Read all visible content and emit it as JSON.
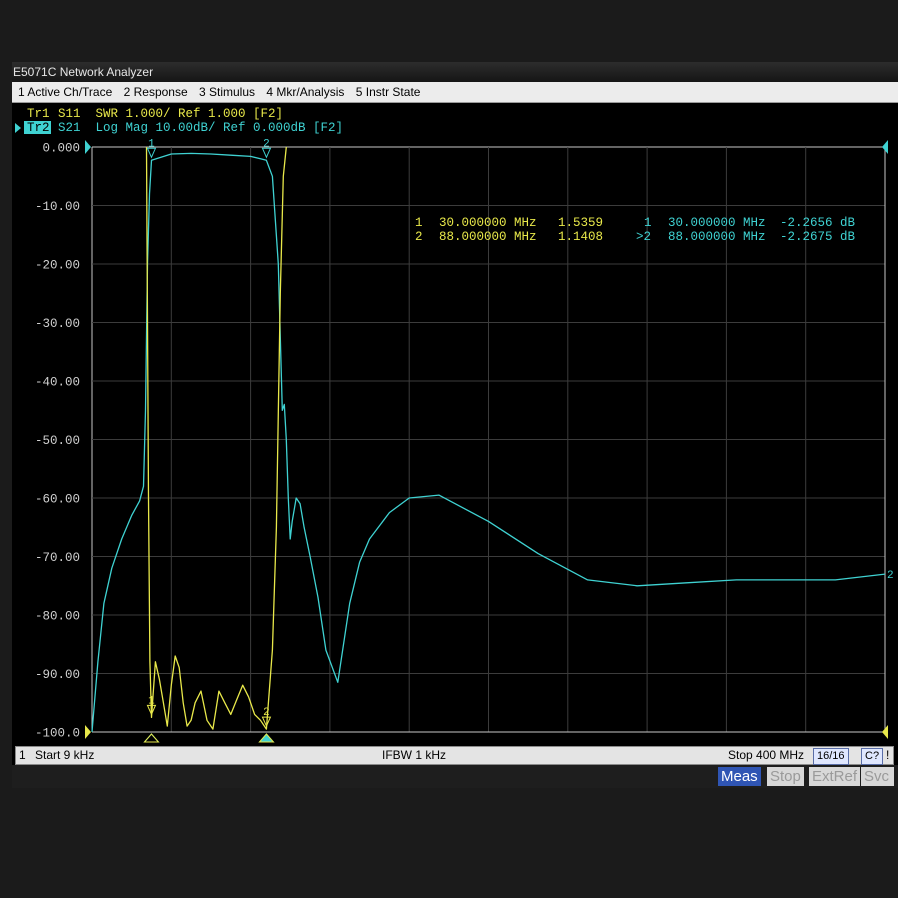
{
  "window": {
    "title": "E5071C Network Analyzer"
  },
  "menu": [
    "1 Active Ch/Trace",
    "2 Response",
    "3 Stimulus",
    "4 Mkr/Analysis",
    "5 Instr State"
  ],
  "traces": {
    "tr1": {
      "id": "Tr1",
      "label": "S11  SWR 1.000/ Ref 1.000 [F2]",
      "color": "#e8e84a"
    },
    "tr2": {
      "id": "Tr2",
      "label": "S21  Log Mag 10.00dB/ Ref 0.000dB [F2]",
      "color": "#3fd2d2"
    }
  },
  "markers": {
    "tr1": [
      {
        "num": "1",
        "freq": "30.000000 MHz",
        "value": "1.5359"
      },
      {
        "num": "2",
        "freq": "88.000000 MHz",
        "value": "1.1408"
      }
    ],
    "tr2": [
      {
        "num": "1",
        "freq": "30.000000 MHz",
        "value": "-2.2656 dB"
      },
      {
        "num": ">2",
        "freq": "88.000000 MHz",
        "value": "-2.2675 dB"
      }
    ]
  },
  "status": {
    "channel": "1",
    "start": "Start 9 kHz",
    "ifbw": "IFBW 1 kHz",
    "stop": "Stop 400 MHz",
    "count": "16/16",
    "cal": "C?",
    "flag": "!"
  },
  "bottom_tabs": {
    "meas": "Meas",
    "stop": "Stop",
    "extref": "ExtRef",
    "svc": "Svc"
  },
  "chart_data": {
    "type": "line",
    "x_range_mhz": [
      0.009,
      400
    ],
    "y_range": [
      -100,
      0
    ],
    "y_tick_labels": [
      "0.000",
      "-10.00",
      "-20.00",
      "-30.00",
      "-40.00",
      "-50.00",
      "-60.00",
      "-70.00",
      "-80.00",
      "-90.00",
      "-100.0"
    ],
    "grid": true,
    "series": [
      {
        "name": "Tr2",
        "x": [
          0.009,
          3,
          6,
          10,
          15,
          20,
          24,
          26,
          27,
          28,
          29,
          30,
          40,
          50,
          60,
          70,
          80,
          85,
          88,
          91,
          94,
          96,
          97,
          98,
          99,
          100,
          101,
          103,
          105,
          107,
          110,
          114,
          118,
          124,
          130,
          135,
          140,
          150,
          160,
          175,
          200,
          225,
          250,
          275,
          300,
          325,
          350,
          375,
          400
        ],
        "y": [
          -100,
          -88,
          -78,
          -72,
          -67,
          -63,
          -60.5,
          -58,
          -45,
          -20,
          -8,
          -2.27,
          -1.2,
          -1.1,
          -1.2,
          -1.4,
          -1.6,
          -2.0,
          -2.27,
          -5,
          -20,
          -45,
          -44,
          -50,
          -60,
          -67,
          -64,
          -60,
          -61,
          -65,
          -70,
          -77,
          -86,
          -91.5,
          -78,
          -71,
          -67,
          -62.5,
          -60,
          -59.5,
          -64,
          -69.5,
          -74,
          -75,
          -74.5,
          -74,
          -74,
          -74,
          -73
        ]
      },
      {
        "name": "Tr1",
        "x": [
          27.5,
          28.5,
          29.2,
          30,
          32,
          34,
          36,
          38,
          40,
          42,
          44,
          46,
          48,
          50,
          52,
          55,
          58,
          61,
          64,
          67,
          70,
          73,
          76,
          79,
          82,
          85,
          88,
          91,
          93,
          95,
          96.5,
          98
        ],
        "y": [
          0,
          -60,
          -88,
          -97.5,
          -88,
          -91,
          -95,
          -99,
          -92,
          -87,
          -89,
          -95,
          -99,
          -98,
          -95,
          -93,
          -98,
          -99.5,
          -93,
          -95,
          -97,
          -94.5,
          -92,
          -94,
          -97,
          -98,
          -99.5,
          -86,
          -65,
          -25,
          -5,
          0
        ]
      }
    ],
    "marker_points": [
      {
        "trace": "Tr2",
        "num": "1",
        "x": 30
      },
      {
        "trace": "Tr2",
        "num": "2",
        "x": 88
      },
      {
        "trace": "Tr1",
        "num": "1",
        "x": 30
      },
      {
        "trace": "Tr1",
        "num": "2",
        "x": 88
      }
    ]
  }
}
